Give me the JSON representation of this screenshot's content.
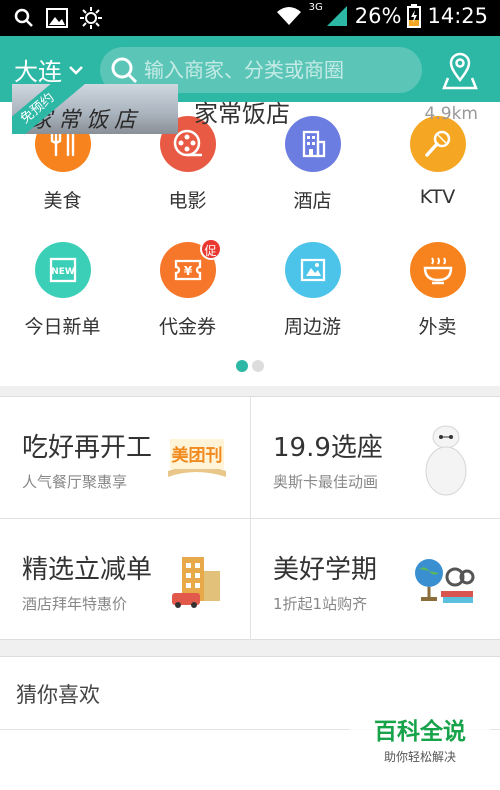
{
  "status_bar": {
    "network": "3G",
    "battery": "26%",
    "time": "14:25"
  },
  "header": {
    "city": "大连",
    "search_placeholder": "输入商家、分类或商圈"
  },
  "categories": [
    {
      "label": "美食",
      "icon": "fork-knife-icon",
      "color": "#f7831e"
    },
    {
      "label": "电影",
      "icon": "film-reel-icon",
      "color": "#e95a45"
    },
    {
      "label": "酒店",
      "icon": "building-icon",
      "color": "#6b7de0"
    },
    {
      "label": "KTV",
      "icon": "microphone-icon",
      "color": "#f5a623"
    },
    {
      "label": "今日新单",
      "icon": "new-badge-icon",
      "color": "#3ccfb8"
    },
    {
      "label": "代金券",
      "icon": "voucher-icon",
      "color": "#f6762a",
      "badge": "促"
    },
    {
      "label": "周边游",
      "icon": "ticket-icon",
      "color": "#4cc3e8"
    },
    {
      "label": "外卖",
      "icon": "bowl-icon",
      "color": "#f7831e"
    }
  ],
  "pager": {
    "pages": 2,
    "active": 1
  },
  "promos": [
    {
      "title": "吃好再开工",
      "subtitle": "人气餐厅聚惠享",
      "graphic": "美团刊"
    },
    {
      "title": "19.9选座",
      "subtitle": "奥斯卡最佳动画"
    },
    {
      "title": "精选立减单",
      "subtitle": "酒店拜年特惠价"
    },
    {
      "title": "美好学期",
      "subtitle": "1折起1站购齐"
    }
  ],
  "guess": {
    "title": "猜你喜欢",
    "items": [
      {
        "ribbon": "免预约",
        "storefront": "家常饭店",
        "name": "家常饭店",
        "distance": "4.9km"
      }
    ]
  },
  "watermark": {
    "title": "百科全说",
    "subtitle": "助你轻松解决"
  },
  "colors": {
    "accent": "#2db7a5"
  }
}
